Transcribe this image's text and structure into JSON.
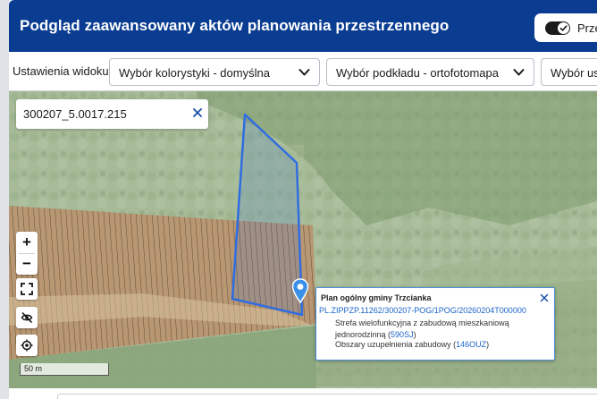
{
  "header": {
    "title": "Podgląd zaawansowany aktów planowania przestrzennego",
    "toggle_label": "Przezroczystość"
  },
  "toolbar": {
    "settings_label": "Ustawienia widoku",
    "color_scheme_select": "Wybór kolorystyki - domyślna",
    "basemap_select": "Wybór podkładu - ortofotomapa",
    "services_select": "Wybór usług"
  },
  "search": {
    "value": "300207_5.0017.215"
  },
  "zoom": {
    "in_label": "+",
    "out_label": "−"
  },
  "scale": {
    "label": "50 m"
  },
  "popup": {
    "title": "Plan ogólny gminy Trzcianka",
    "plan_id": "PL.ZIPPZP.11262/300207-POG/1POG/20260204T000000",
    "zone_text": "Strefa wielofunkcyjna z zabudową mieszkaniową jednorodzinną",
    "zone_code": "590SJ",
    "area_text": "Obszary uzupełnienia zabudowy",
    "area_code": "146OUZ"
  },
  "colors": {
    "header_bg": "#0a3d91",
    "parcel_outline": "#2f6de0",
    "link": "#1a63c9"
  },
  "icons": {
    "toggle": "check-icon",
    "dropdown": "chevron-down-icon",
    "clear": "close-icon",
    "fullscreen": "fullscreen-icon",
    "hide": "eye-off-icon",
    "locate": "crosshair-icon",
    "marker": "map-pin-icon"
  }
}
